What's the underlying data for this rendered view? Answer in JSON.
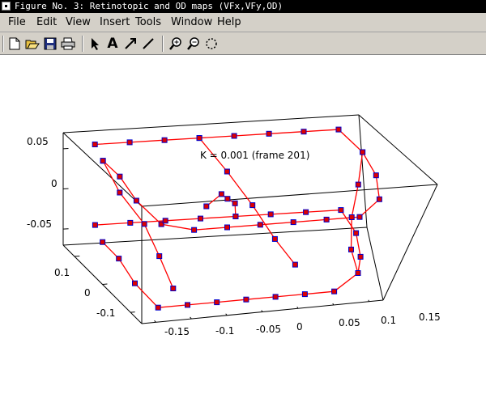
{
  "window": {
    "title": "Figure No. 3: Retinotopic and OD maps (VFx,VFy,OD)"
  },
  "menu": [
    "File",
    "Edit",
    "View",
    "Insert",
    "Tools",
    "Window",
    "Help"
  ],
  "toolbar": [
    "new-file-icon",
    "open-folder-icon",
    "save-icon",
    "print-icon",
    "select-arrow-icon",
    "insert-text-icon",
    "insert-arrow-icon",
    "insert-line-icon",
    "zoom-in-icon",
    "zoom-out-icon",
    "rotate-icon"
  ],
  "colors": {
    "titlebar": "#000000",
    "chrome": "#d4d0c8",
    "line": "#ff0000",
    "marker_fill": "#dd0000",
    "marker_edge": "#0000cc"
  },
  "chart_data": {
    "type": "line",
    "title": "K = 0.001 (frame 201)",
    "x_ticks": [
      "-0.15",
      "-0.1",
      "-0.05",
      "0",
      "0.05",
      "0.1",
      "0.15"
    ],
    "y_ticks": [
      "-0.1",
      "0",
      "0.1"
    ],
    "z_ticks": [
      "-0.05",
      "0",
      "0.05"
    ],
    "xlim": [
      -0.17,
      0.17
    ],
    "ylim": [
      -0.14,
      0.14
    ],
    "zlim": [
      -0.07,
      0.07
    ],
    "view": "3-D box, perspective",
    "markers": "red filled squares with blue outline",
    "series": [
      {
        "points": [
          [
            -0.14,
            0.12,
            0.06
          ],
          [
            -0.1,
            0.12,
            0.06
          ],
          [
            -0.06,
            0.12,
            0.06
          ],
          [
            -0.02,
            0.12,
            0.06
          ],
          [
            0.02,
            0.12,
            0.06
          ],
          [
            0.06,
            0.12,
            0.06
          ],
          [
            0.1,
            0.12,
            0.06
          ],
          [
            0.14,
            0.12,
            0.06
          ],
          [
            0.15,
            0.06,
            0.05
          ],
          [
            0.15,
            0,
            0.04
          ],
          [
            0.14,
            -0.06,
            0.03
          ],
          [
            0.1,
            -0.12,
            0.03
          ],
          [
            0.06,
            -0.12,
            0.03
          ],
          [
            0.02,
            -0.12,
            0.03
          ],
          [
            -0.02,
            -0.12,
            0.03
          ],
          [
            -0.06,
            -0.12,
            0.03
          ],
          [
            -0.1,
            -0.12,
            0.03
          ],
          [
            -0.14,
            -0.12,
            0.04
          ],
          [
            -0.15,
            -0.06,
            0.05
          ],
          [
            -0.15,
            0,
            0.06
          ],
          [
            -0.15,
            0.06,
            0.06
          ]
        ]
      },
      {
        "points": [
          [
            -0.14,
            0.12,
            -0.04
          ],
          [
            -0.1,
            0.12,
            -0.04
          ],
          [
            -0.06,
            0.12,
            -0.04
          ],
          [
            -0.02,
            0.12,
            -0.04
          ],
          [
            0.02,
            0.12,
            -0.04
          ],
          [
            0.06,
            0.12,
            -0.04
          ],
          [
            0.1,
            0.12,
            -0.04
          ],
          [
            0.14,
            0.12,
            -0.04
          ],
          [
            0.15,
            0.06,
            -0.05
          ],
          [
            0.15,
            0,
            -0.06
          ],
          [
            0.14,
            -0.06,
            -0.06
          ],
          [
            0.1,
            -0.12,
            -0.06
          ],
          [
            0.06,
            -0.12,
            -0.06
          ],
          [
            0.02,
            -0.12,
            -0.06
          ],
          [
            -0.02,
            -0.12,
            -0.06
          ],
          [
            -0.06,
            -0.12,
            -0.06
          ],
          [
            -0.1,
            -0.12,
            -0.06
          ],
          [
            -0.14,
            -0.12,
            -0.06
          ],
          [
            -0.15,
            -0.06,
            -0.05
          ],
          [
            -0.15,
            0,
            -0.04
          ],
          [
            -0.15,
            0.06,
            -0.04
          ]
        ]
      },
      {
        "points": [
          [
            -0.15,
            0.06,
            0.06
          ],
          [
            -0.14,
            0.03,
            0.03
          ],
          [
            -0.12,
            0,
            0
          ],
          [
            -0.11,
            -0.03,
            -0.03
          ],
          [
            -0.1,
            -0.06,
            -0.06
          ]
        ]
      },
      {
        "points": [
          [
            0.15,
            0.06,
            0.05
          ],
          [
            0.14,
            0.03,
            0.02
          ],
          [
            0.13,
            0,
            -0.01
          ],
          [
            0.13,
            -0.03,
            -0.04
          ],
          [
            0.14,
            -0.06,
            -0.06
          ]
        ]
      },
      {
        "points": [
          [
            -0.02,
            0.12,
            0.06
          ],
          [
            0,
            0.08,
            0.03
          ],
          [
            0.02,
            0.04,
            0
          ],
          [
            0.04,
            0,
            -0.03
          ],
          [
            0.06,
            -0.04,
            -0.05
          ]
        ]
      },
      {
        "points": [
          [
            0.02,
            0.12,
            -0.04
          ],
          [
            0.01,
            0.08,
            -0.01
          ],
          [
            -0.01,
            0.04,
            0.01
          ],
          [
            -0.03,
            0,
            0.03
          ],
          [
            -0.06,
            -0.04,
            0.03
          ]
        ]
      }
    ]
  }
}
